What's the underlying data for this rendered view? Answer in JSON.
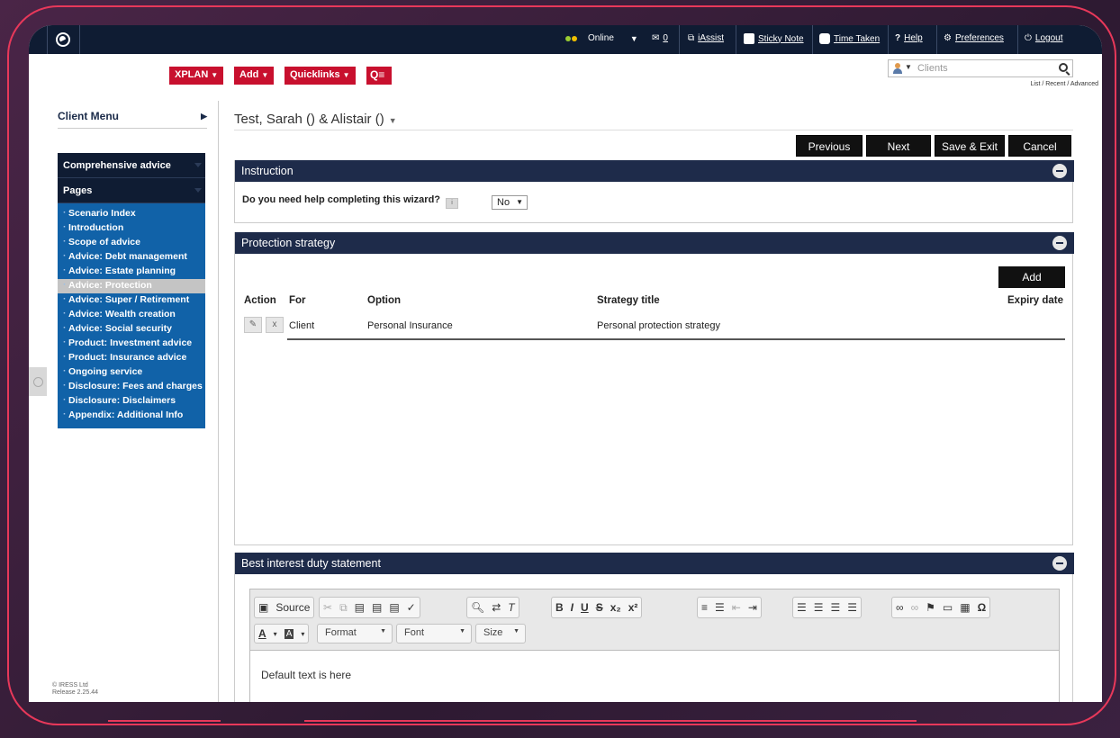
{
  "topbar": {
    "online": "Online",
    "mail_count": "0",
    "iassist": "iAssist",
    "sticky": "Sticky Note",
    "time": "Time Taken",
    "help": "Help",
    "help_q": "?",
    "prefs": "Preferences",
    "logout": "Logout"
  },
  "menus": {
    "xplan": "XPLAN",
    "add": "Add",
    "quicklinks": "Quicklinks"
  },
  "search": {
    "placeholder": "Clients",
    "links": "List / Recent / Advanced"
  },
  "sidebar": {
    "client_menu": "Client Menu",
    "section": "Comprehensive advice",
    "pages_label": "Pages",
    "items": [
      "Scenario Index",
      "Introduction",
      "Scope of advice",
      "Advice: Debt management",
      "Advice: Estate planning",
      "Advice: Protection",
      "Advice: Super / Retirement",
      "Advice: Wealth creation",
      "Advice: Social security",
      "Product: Investment advice",
      "Product: Insurance advice",
      "Ongoing service",
      "Disclosure: Fees and charges",
      "Disclosure: Disclaimers",
      "Appendix: Additional Info"
    ],
    "active_index": 5,
    "footer_line1": "© IRESS Ltd",
    "footer_line2": "Release 2.25.44"
  },
  "main": {
    "client_title": "Test, Sarah () & Alistair ()",
    "nav": {
      "previous": "Previous",
      "next": "Next",
      "save_exit": "Save & Exit",
      "cancel": "Cancel"
    },
    "instruction": {
      "title": "Instruction",
      "question": "Do you need help completing this wizard?",
      "info": "i",
      "answer": "No"
    },
    "protection": {
      "title": "Protection strategy",
      "add": "Add",
      "columns": [
        "Action",
        "For",
        "Option",
        "Strategy title",
        "Expiry date"
      ],
      "rows": [
        {
          "for": "Client",
          "option": "Personal Insurance",
          "strategy": "Personal protection strategy",
          "expiry": ""
        }
      ]
    },
    "bestinterest": {
      "title": "Best interest duty statement",
      "source": "Source",
      "format": "Format",
      "font": "Font",
      "size": "Size",
      "text": "Default text is here"
    }
  },
  "colors": {
    "navy": "#1e2b4a",
    "red": "#c8102e",
    "sidebar_blue": "#1162a8",
    "frame": "#e8385a"
  }
}
